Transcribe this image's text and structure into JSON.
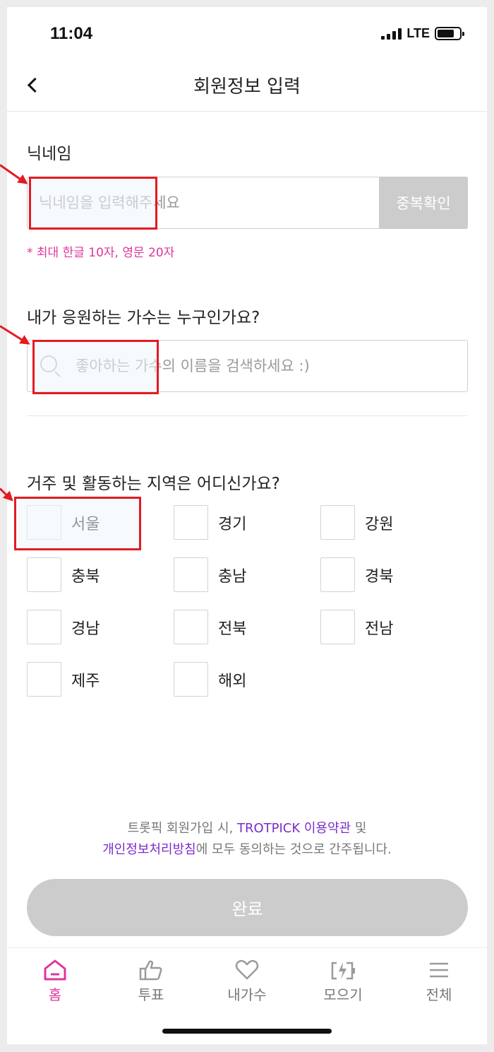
{
  "status_bar": {
    "time": "11:04",
    "network": "LTE"
  },
  "header": {
    "title": "회원정보 입력",
    "back_icon": "chevron-left-icon"
  },
  "nickname": {
    "label": "닉네임",
    "placeholder": "닉네임을 입력해주세요",
    "value": "",
    "check_button": "중복확인",
    "hint": "* 최대 한글 10자, 영문 20자"
  },
  "singer": {
    "label": "내가 응원하는 가수는 누구인가요?",
    "placeholder": "좋아하는 가수의 이름을 검색하세요 :)",
    "icon": "search-icon"
  },
  "region": {
    "label": "거주 및 활동하는 지역은 어디신가요?",
    "options": [
      "서울",
      "경기",
      "강원",
      "충북",
      "충남",
      "경북",
      "경남",
      "전북",
      "전남",
      "제주",
      "해외"
    ]
  },
  "terms": {
    "prefix": "트롯픽 회원가입 시, ",
    "terms_link": "TROTPICK 이용약관",
    "and": " 및",
    "privacy_link": "개인정보처리방침",
    "suffix": "에 모두 동의하는 것으로 간주됩니다."
  },
  "submit_label": "완료",
  "tabs": [
    {
      "label": "홈",
      "icon": "home-icon",
      "active": true
    },
    {
      "label": "투표",
      "icon": "thumbs-up-icon",
      "active": false
    },
    {
      "label": "내가수",
      "icon": "heart-icon",
      "active": false
    },
    {
      "label": "모으기",
      "icon": "battery-charge-icon",
      "active": false
    },
    {
      "label": "전체",
      "icon": "menu-icon",
      "active": false
    }
  ],
  "colors": {
    "accent": "#e0359b",
    "link": "#7b2cc9",
    "disabled": "#cccccc",
    "annotation": "#e21b23"
  }
}
